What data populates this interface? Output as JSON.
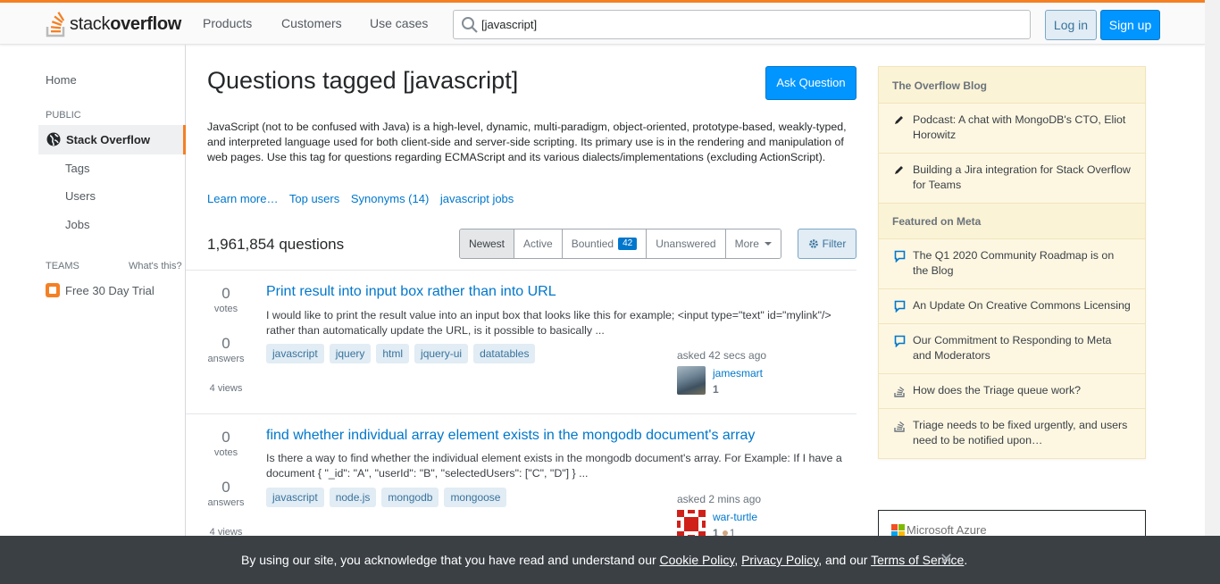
{
  "logo": {
    "text_plain": "stack",
    "text_bold": "overflow"
  },
  "topnav": [
    "Products",
    "Customers",
    "Use cases"
  ],
  "search": {
    "value": "[javascript]"
  },
  "auth": {
    "login": "Log in",
    "signup": "Sign up"
  },
  "sidebar": {
    "home": "Home",
    "public_label": "PUBLIC",
    "stack_overflow": "Stack Overflow",
    "sub_items": [
      "Tags",
      "Users",
      "Jobs"
    ],
    "teams_label": "TEAMS",
    "whats_this": "What's this?",
    "trial": "Free 30 Day Trial"
  },
  "main": {
    "title": "Questions tagged [javascript]",
    "ask_button": "Ask Question",
    "description": "JavaScript (not to be confused with Java) is a high-level, dynamic, multi-paradigm, object-oriented, prototype-based, weakly-typed, and interpreted language used for both client-side and server-side scripting. Its primary use is in the rendering and manipulation of web pages. Use this tag for questions regarding ECMAScript and its various dialects/implementations (excluding ActionScript).",
    "links": [
      "Learn more…",
      "Top users",
      "Synonyms (14)",
      "javascript jobs"
    ],
    "question_count": "1,961,854 questions",
    "tabs": {
      "newest": "Newest",
      "active": "Active",
      "bountied": "Bountied",
      "bounty_count": "42",
      "unanswered": "Unanswered",
      "more": "More"
    },
    "filter": "Filter"
  },
  "questions": [
    {
      "votes": "0",
      "votes_label": "votes",
      "answers": "0",
      "answers_label": "answers",
      "views": "4 views",
      "title": "Print result into input box rather than into URL",
      "excerpt": "I would like to print the result value into an input box that looks like this for example; <input type=\"text\" id=\"mylink\"/> rather than automatically update the URL, is it possible to basically ...",
      "tags": [
        "javascript",
        "jquery",
        "html",
        "jquery-ui",
        "datatables"
      ],
      "asked": "asked 42 secs ago",
      "user": "jamesmart",
      "rep": "1"
    },
    {
      "votes": "0",
      "votes_label": "votes",
      "answers": "0",
      "answers_label": "answers",
      "views": "4 views",
      "title": "find whether individual array element exists in the mongodb document's array",
      "excerpt": "Is there a way to find whether the individual element exists in the mongodb document's array. For Example: If I have a document { \"_id\": \"A\", \"userId\": \"B\", \"selectedUsers\": [\"C\", \"D\"] } ...",
      "tags": [
        "javascript",
        "node.js",
        "mongodb",
        "mongoose"
      ],
      "asked": "asked 2 mins ago",
      "user": "war-turtle",
      "rep": "1",
      "bronze": "1"
    }
  ],
  "blog": {
    "header": "The Overflow Blog",
    "items": [
      "Podcast: A chat with MongoDB's CTO, Eliot Horowitz",
      "Building a Jira integration for Stack Overflow for Teams"
    ],
    "meta_header": "Featured on Meta",
    "meta_items": [
      "The Q1 2020 Community Roadmap is on the Blog",
      "An Update On Creative Commons Licensing",
      "Our Commitment to Responding to Meta and Moderators",
      "How does the Triage queue work?",
      "Triage needs to be fixed urgently, and users need to be notified upon…"
    ]
  },
  "ad": {
    "text": "Microsoft Azure"
  },
  "cookie": {
    "text1": "By using our site, you acknowledge that you have read and understand our ",
    "cookie_policy": "Cookie Policy",
    "sep1": ", ",
    "privacy_policy": "Privacy Policy",
    "sep2": ", and our ",
    "terms": "Terms of Service",
    "end": ".",
    "close": "✕"
  },
  "colors": {
    "accent": "#f48024",
    "link": "#0077cc",
    "primary_button": "#0095ff"
  }
}
